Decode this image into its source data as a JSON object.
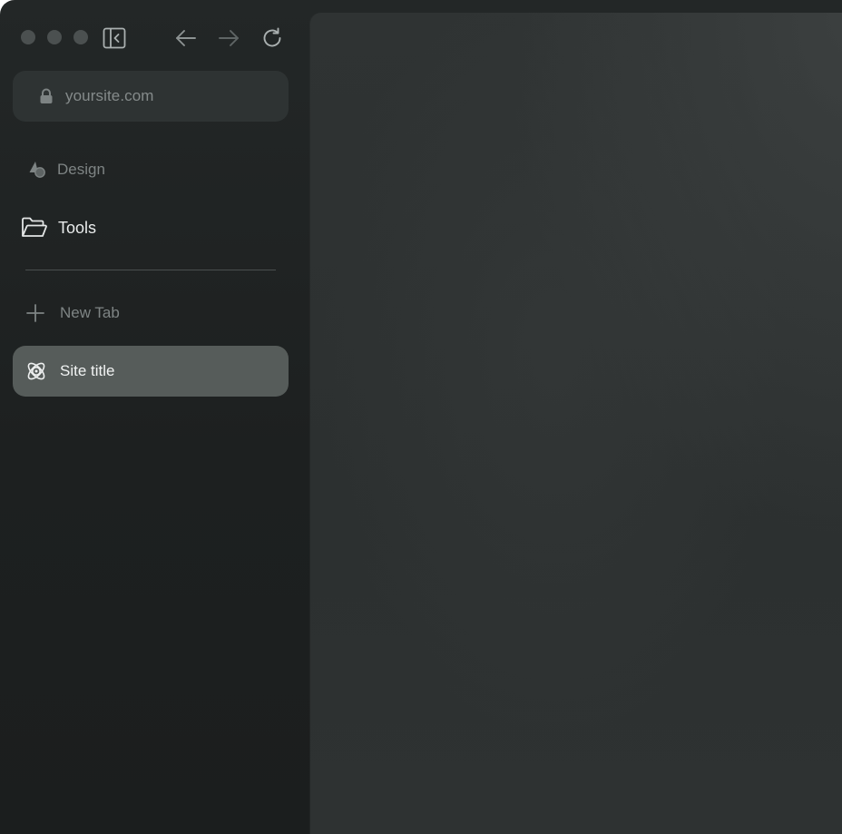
{
  "toolbar": {
    "traffic_lights": [
      "close",
      "minimize",
      "zoom"
    ],
    "traffic_color": "#4b5050",
    "icons": {
      "sidebar_toggle": "sidebar-toggle-icon",
      "back": "arrow-left-icon",
      "forward": "arrow-right-icon",
      "reload": "reload-icon"
    }
  },
  "address_bar": {
    "value": "yoursite.com",
    "icon": "lock-icon"
  },
  "sidebar": {
    "items": [
      {
        "label": "Design",
        "icon": "shapes-icon",
        "active": false
      },
      {
        "label": "Tools",
        "icon": "folder-open-icon",
        "active": false
      },
      {
        "label": "New Tab",
        "icon": "plus-icon",
        "active": false
      },
      {
        "label": "Site title",
        "icon": "orbit-icon",
        "active": true
      }
    ]
  },
  "colors": {
    "window_background": "#1e2121",
    "sidebar_selected": "#565c5a",
    "content_background": "#2e3232",
    "text_primary": "#e9ecec",
    "text_muted": "#7e8484"
  }
}
